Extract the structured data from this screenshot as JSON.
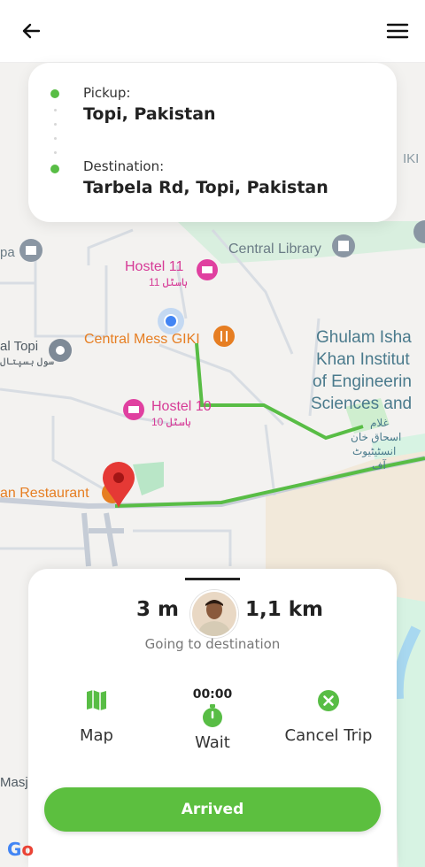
{
  "header": {
    "back_icon": "back-arrow-icon",
    "menu_icon": "hamburger-menu-icon"
  },
  "route": {
    "pickup_label": "Pickup:",
    "pickup_value": "Topi, Pakistan",
    "destination_label": "Destination:",
    "destination_value": "Tarbela Rd, Topi, Pakistan"
  },
  "map": {
    "labels": {
      "central_library": "Central Library",
      "hostel_11": "Hostel 11",
      "hostel_11_urdu": "ہاسٹل 11",
      "central_mess": "Central Mess GIKI",
      "hostel_10": "Hostel 10",
      "hostel_10_urdu": "ہاسٹل 10",
      "ghulam_1": "Ghulam Isha",
      "ghulam_2": "Khan Institut",
      "ghulam_3": "of Engineerin",
      "ghulam_4": "Sciences and",
      "ghulam_urdu_1": "غلام",
      "ghulam_urdu_2": "اسحاق خان",
      "ghulam_urdu_3": "انسٹیٹیوٹ",
      "ghulam_urdu_4": "آف",
      "al_topi": "al Topi",
      "al_topi_urdu": "سول ہسپتال",
      "restaurant": "an Restaurant",
      "left_pa": "pa",
      "masj": "Masj",
      "giki_edge": "IKI"
    },
    "colors": {
      "route": "#58bd45",
      "pin": "#e53935",
      "hostel": "#e040a0",
      "food": "#e67e22",
      "institution": "#4a7a8c"
    }
  },
  "trip": {
    "time": "3 m",
    "distance": "1,1 km",
    "status": "Going to destination",
    "actions": {
      "map_label": "Map",
      "wait_label": "Wait",
      "wait_timer": "00:00",
      "cancel_label": "Cancel Trip"
    },
    "arrived_button": "Arrived"
  },
  "attribution": {
    "google_partial": "Go"
  }
}
